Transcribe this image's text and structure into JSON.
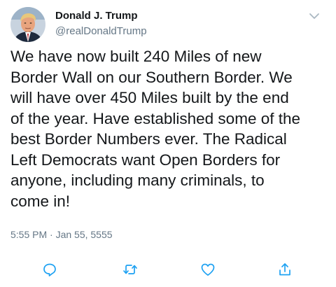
{
  "user": {
    "display_name": "Donald J. Trump",
    "handle": "@realDonaldTrump",
    "avatar_icon": "profile-photo"
  },
  "tweet": {
    "text": "We have now built 240 Miles of new\nBorder Wall on our Southern Border. We\nwill have over 450 Miles built by the end\nof the year. Have established some of the\nbest Border Numbers ever. The Radical\nLeft Democrats want Open Borders for\nanyone, including many criminals, to\ncome in!",
    "timestamp": "5:55 PM · Jan 55, 5555"
  },
  "actions": [
    {
      "icon": "reply-icon"
    },
    {
      "icon": "retweet-icon"
    },
    {
      "icon": "like-icon"
    },
    {
      "icon": "share-icon"
    }
  ],
  "colors": {
    "text_primary": "#14171a",
    "text_secondary": "#657786",
    "icon_accent": "#1da1f2",
    "caret": "#aab8c2"
  }
}
